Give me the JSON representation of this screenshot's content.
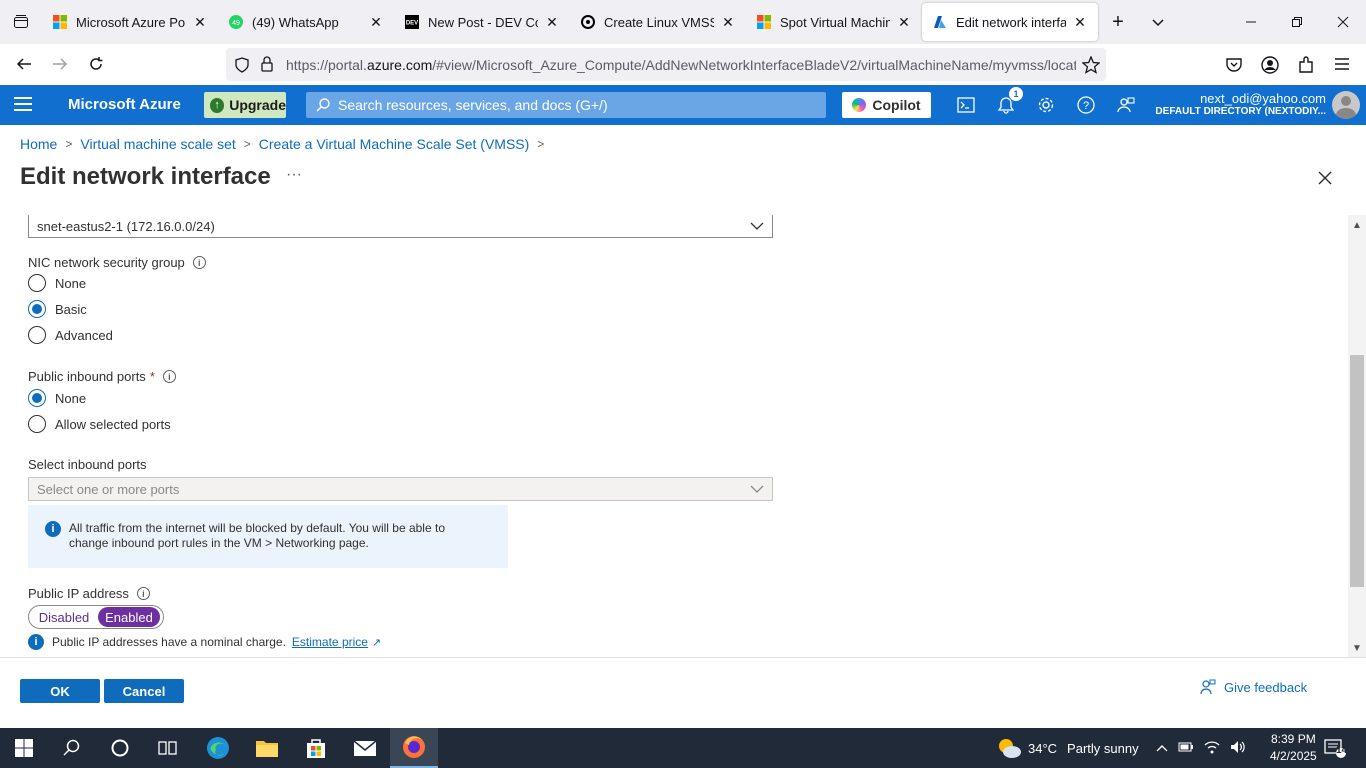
{
  "browser": {
    "tabs": [
      {
        "title": "Microsoft Azure Portal",
        "icon": "microsoft-logo-icon",
        "active": false
      },
      {
        "title": "(49) WhatsApp",
        "icon": "whatsapp-icon",
        "active": false
      },
      {
        "title": "New Post - DEV Comm",
        "icon": "dev-icon",
        "active": false
      },
      {
        "title": "Create Linux VMSS",
        "icon": "openai-icon",
        "active": false
      },
      {
        "title": "Spot Virtual Machines",
        "icon": "microsoft-logo-icon",
        "active": false
      },
      {
        "title": "Edit network interface",
        "icon": "azure-icon",
        "active": true
      }
    ],
    "url_prefix": "https://portal.",
    "url_domain": "azure.com",
    "url_rest": "/#view/Microsoft_Azure_Compute/AddNewNetworkInterfaceBladeV2/virtualMachineName/myvmss/locat"
  },
  "azure_header": {
    "brand": "Microsoft Azure",
    "upgrade_label": "Upgrade",
    "search_placeholder": "Search resources, services, and docs (G+/)",
    "copilot_label": "Copilot",
    "notification_count": "1",
    "account_email": "next_odi@yahoo.com",
    "account_directory": "DEFAULT DIRECTORY (NEXTODIY..."
  },
  "breadcrumb": [
    "Home",
    "Virtual machine scale set",
    "Create a Virtual Machine Scale Set (VMSS)"
  ],
  "page": {
    "title": "Edit network interface",
    "ellipsis": "···"
  },
  "form": {
    "subnet_value": "snet-eastus2-1 (172.16.0.0/24)",
    "nsg_label": "NIC network security group",
    "nsg_options": [
      "None",
      "Basic",
      "Advanced"
    ],
    "nsg_selected": "Basic",
    "inbound_label": "Public inbound ports",
    "inbound_required": "*",
    "inbound_options": [
      "None",
      "Allow selected ports"
    ],
    "inbound_selected": "None",
    "select_ports_label": "Select inbound ports",
    "select_ports_placeholder": "Select one or more ports",
    "info_text": "All traffic from the internet will be blocked by default. You will be able to change inbound port rules in the VM > Networking page.",
    "public_ip_label": "Public IP address",
    "public_ip_options": [
      "Disabled",
      "Enabled"
    ],
    "public_ip_selected": "Enabled",
    "public_ip_note": "Public IP addresses have a nominal charge.",
    "estimate_link": "Estimate price"
  },
  "footer": {
    "ok_label": "OK",
    "cancel_label": "Cancel",
    "feedback_label": "Give feedback"
  },
  "taskbar": {
    "weather_temp": "34°C",
    "weather_desc": "Partly sunny",
    "time": "8:39 PM",
    "date": "4/2/2025",
    "notification_count": "14"
  },
  "colors": {
    "azure_blue": "#1170cf",
    "primary_button": "#0f6cbd",
    "toggle_selected": "#6e2fa0"
  }
}
